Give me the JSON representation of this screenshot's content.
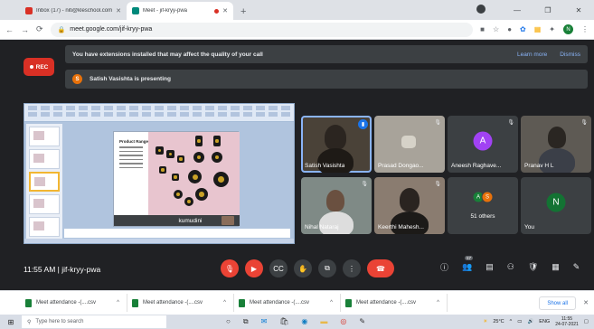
{
  "browser": {
    "tabs": [
      {
        "title": "Inbox (17) - niti@kleschool.com",
        "favicon_color": "#d93025",
        "active": false
      },
      {
        "title": "Meet - jif-kryy-pwa",
        "favicon_color": "#00897b",
        "active": true
      }
    ],
    "url": "meet.google.com/jif-kryy-pwa",
    "profile_initial": "N"
  },
  "banners": {
    "warning": "You have extensions installed that may affect the quality of your call",
    "learn_more": "Learn more",
    "dismiss": "Dismiss",
    "presenting_initial": "S",
    "presenting": "Satish Vasishta is presenting"
  },
  "rec_label": "REC",
  "presentation": {
    "slide_title": "Product Range",
    "footer_name": "kumudini"
  },
  "participants": [
    {
      "name": "Satish Vasishta",
      "kind": "video",
      "speaking": true
    },
    {
      "name": "Prasad Dongao...",
      "kind": "video",
      "speaking": false
    },
    {
      "name": "Aneesh Raghave...",
      "kind": "avatar",
      "initial": "A",
      "color": "#a142f4"
    },
    {
      "name": "Pranav H L",
      "kind": "video",
      "speaking": false
    },
    {
      "name": "Nihal Nataraj",
      "kind": "video",
      "speaking": false
    },
    {
      "name": "Keerthi Mahesh...",
      "kind": "video",
      "speaking": false
    },
    {
      "name": "51 others",
      "kind": "others",
      "initials": [
        "A",
        "S"
      ],
      "colors": [
        "#188038",
        "#e8710a"
      ]
    },
    {
      "name": "You",
      "kind": "avatar",
      "initial": "N",
      "color": "#137333"
    }
  ],
  "meeting": {
    "time": "11:55 AM",
    "code": "jif-kryy-pwa",
    "people_count": "57"
  },
  "downloads": {
    "items": [
      "Meet attendance -(....csv",
      "Meet attendance -(....csv",
      "Meet attendance -(....csv",
      "Meet attendance -(....csv"
    ],
    "show_all": "Show all"
  },
  "taskbar": {
    "search_placeholder": "Type here to search",
    "temperature": "25°C",
    "language": "ENG",
    "time": "11:55",
    "date": "24-07-2021"
  }
}
